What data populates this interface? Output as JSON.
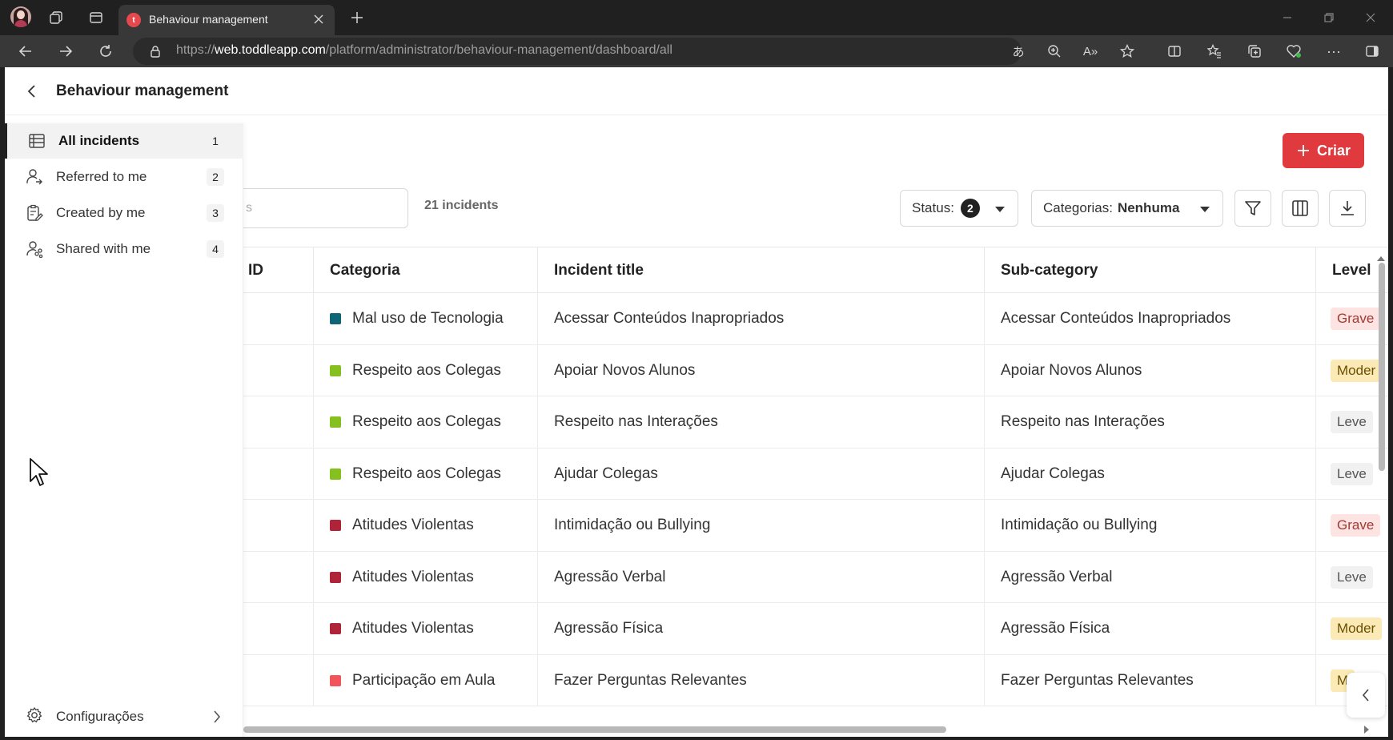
{
  "browser": {
    "tab_title": "Behaviour management",
    "url_prefix": "https://",
    "url_domain": "web.toddleapp.com",
    "url_path": "/platform/administrator/behaviour-management/dashboard/all"
  },
  "header": {
    "title": "Behaviour management"
  },
  "sidebar": {
    "items": [
      {
        "label": "All incidents",
        "count": "1",
        "icon": "list-icon",
        "active": true
      },
      {
        "label": "Referred to me",
        "count": "2",
        "icon": "user-referred-icon"
      },
      {
        "label": "Created by me",
        "count": "3",
        "icon": "clipboard-edit-icon"
      },
      {
        "label": "Shared with me",
        "count": "4",
        "icon": "user-shared-icon"
      }
    ],
    "settings_label": "Configurações"
  },
  "toolbar": {
    "create_label": "Criar",
    "search_placeholder": "s",
    "incident_count": "21 incidents",
    "status_label": "Status:",
    "status_count": "2",
    "categories_label": "Categorias:",
    "categories_value": "Nenhuma"
  },
  "table": {
    "columns": [
      "ID",
      "Categoria",
      "Incident title",
      "Sub-category",
      "Level"
    ],
    "rows": [
      {
        "category": "Mal uso de Tecnologia",
        "color": "#0e6577",
        "title": "Acessar Conteúdos Inapropriados",
        "sub": "Acessar Conteúdos Inapropriados",
        "level": "Grave",
        "level_type": "grave"
      },
      {
        "category": "Respeito aos Colegas",
        "color": "#86c01e",
        "title": "Apoiar Novos Alunos",
        "sub": "Apoiar Novos Alunos",
        "level": "Moder",
        "level_type": "moder"
      },
      {
        "category": "Respeito aos Colegas",
        "color": "#86c01e",
        "title": "Respeito nas Interações",
        "sub": "Respeito nas Interações",
        "level": "Leve",
        "level_type": "leve"
      },
      {
        "category": "Respeito aos Colegas",
        "color": "#86c01e",
        "title": "Ajudar Colegas",
        "sub": "Ajudar Colegas",
        "level": "Leve",
        "level_type": "leve"
      },
      {
        "category": "Atitudes Violentas",
        "color": "#b0243a",
        "title": "Intimidação ou Bullying",
        "sub": "Intimidação ou Bullying",
        "level": "Grave",
        "level_type": "grave"
      },
      {
        "category": "Atitudes Violentas",
        "color": "#b0243a",
        "title": "Agressão Verbal",
        "sub": "Agressão Verbal",
        "level": "Leve",
        "level_type": "leve"
      },
      {
        "category": "Atitudes Violentas",
        "color": "#b0243a",
        "title": "Agressão Física",
        "sub": "Agressão Física",
        "level": "Moder",
        "level_type": "moder"
      },
      {
        "category": "Participação em Aula",
        "color": "#f2545b",
        "title": "Fazer Perguntas Relevantes",
        "sub": "Fazer Perguntas Relevantes",
        "level": "M",
        "level_type": "moder"
      }
    ]
  }
}
